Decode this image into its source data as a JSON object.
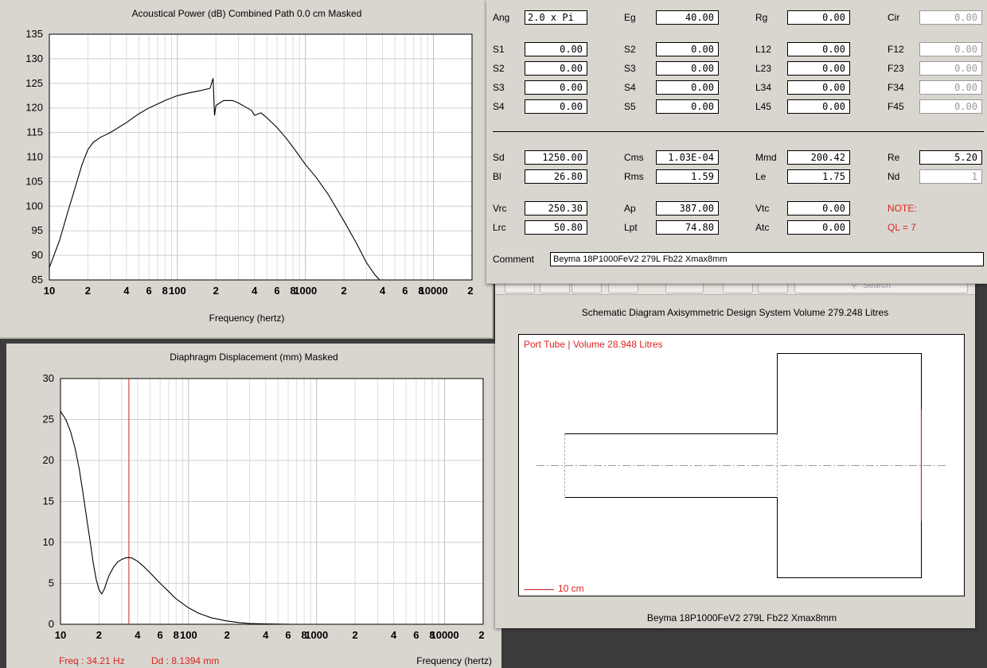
{
  "acoustic_window": {
    "title": "Acoustical Power (dB)   Combined   Path 0.0 cm   Masked",
    "x_caption": "Frequency (hertz)"
  },
  "displacement_window": {
    "title": "Diaphragm Displacement (mm)   Masked",
    "x_caption": "Frequency (hertz)",
    "cursor_freq": "Freq : 34.21 Hz",
    "cursor_dd": "Dd : 8.1394 mm"
  },
  "params_window": {
    "rows": [
      [
        {
          "label": "Ang",
          "value": "2.0 x Pi",
          "align": "left"
        },
        {
          "label": "Eg",
          "value": "40.00"
        },
        {
          "label": "Rg",
          "value": "0.00"
        },
        {
          "label": "Cir",
          "value": "0.00",
          "ro": true
        }
      ],
      [
        {
          "label": "S1",
          "value": "0.00"
        },
        {
          "label": "S2",
          "value": "0.00"
        },
        {
          "label": "L12",
          "value": "0.00"
        },
        {
          "label": "F12",
          "value": "0.00",
          "ro": true
        }
      ],
      [
        {
          "label": "S2",
          "value": "0.00"
        },
        {
          "label": "S3",
          "value": "0.00"
        },
        {
          "label": "L23",
          "value": "0.00"
        },
        {
          "label": "F23",
          "value": "0.00",
          "ro": true
        }
      ],
      [
        {
          "label": "S3",
          "value": "0.00"
        },
        {
          "label": "S4",
          "value": "0.00"
        },
        {
          "label": "L34",
          "value": "0.00"
        },
        {
          "label": "F34",
          "value": "0.00",
          "ro": true
        }
      ],
      [
        {
          "label": "S4",
          "value": "0.00"
        },
        {
          "label": "S5",
          "value": "0.00"
        },
        {
          "label": "L45",
          "value": "0.00"
        },
        {
          "label": "F45",
          "value": "0.00",
          "ro": true
        }
      ],
      [
        {
          "label": "Sd",
          "value": "1250.00"
        },
        {
          "label": "Cms",
          "value": "1.03E-04"
        },
        {
          "label": "Mmd",
          "value": "200.42"
        },
        {
          "label": "Re",
          "value": "5.20"
        }
      ],
      [
        {
          "label": "Bl",
          "value": "26.80"
        },
        {
          "label": "Rms",
          "value": "1.59"
        },
        {
          "label": "Le",
          "value": "1.75"
        },
        {
          "label": "Nd",
          "value": "1",
          "ro": true
        }
      ],
      [
        {
          "label": "Vrc",
          "value": "250.30"
        },
        {
          "label": "Ap",
          "value": "387.00"
        },
        {
          "label": "Vtc",
          "value": "0.00"
        },
        {
          "label": "NOTE:",
          "note": true
        }
      ],
      [
        {
          "label": "Lrc",
          "value": "50.80"
        },
        {
          "label": "Lpt",
          "value": "74.80"
        },
        {
          "label": "Atc",
          "value": "0.00"
        },
        {
          "label": "QL = 7",
          "note": true
        }
      ]
    ],
    "comment_label": "Comment",
    "comment_value": "Beyma 18P1000FeV2 279L Fb22  Xmax8mm"
  },
  "toolbar": {
    "search_placeholder": "Search"
  },
  "schematic_window": {
    "title": "Schematic Diagram   Axisymmetric Design   System Volume 279.248 Litres",
    "port_label": "Port Tube | Volume 28.948 Litres",
    "scale_label": "10 cm",
    "footer": "Beyma 18P1000FeV2 279L Fb22  Xmax8mm"
  },
  "colors": {
    "window_bg": "#d9d6cf",
    "accent_red": "#d22222",
    "desktop": "#3c3c3c"
  },
  "chart_data": [
    {
      "type": "line",
      "title": "Acoustical Power (dB)   Combined   Path 0.0 cm   Masked",
      "xlabel": "Frequency (hertz)",
      "ylabel": "",
      "xscale": "log",
      "xlim": [
        10,
        20000
      ],
      "ylim": [
        85,
        135
      ],
      "x_ticks": [
        "10",
        "2",
        "4",
        "6",
        "8",
        "100",
        "2",
        "4",
        "6",
        "8",
        "1000",
        "2",
        "4",
        "6",
        "8",
        "10000",
        "2"
      ],
      "y_ticks": [
        "135",
        "130",
        "125",
        "120",
        "115",
        "110",
        "105",
        "100",
        "95",
        "90",
        "85"
      ],
      "grid": true,
      "series": [
        {
          "x": [
            10,
            12,
            14,
            16,
            18,
            20,
            22,
            25,
            30,
            40,
            50,
            60,
            80,
            100,
            120,
            150,
            180,
            190,
            195,
            200,
            230,
            270,
            300,
            350,
            380,
            400,
            450,
            500,
            600,
            700,
            800,
            1000,
            1200,
            1500,
            2000,
            2500,
            3000,
            3500,
            3800
          ],
          "y": [
            87.5,
            93,
            99,
            104,
            108.5,
            111.5,
            113,
            114,
            115,
            117,
            118.8,
            120,
            121.5,
            122.5,
            123,
            123.5,
            124,
            126,
            118.5,
            120.5,
            121.5,
            121.5,
            121,
            120,
            119.5,
            118.5,
            119,
            118,
            116,
            114,
            112,
            108.5,
            106,
            102.5,
            97,
            92.5,
            88.5,
            86,
            85
          ]
        }
      ]
    },
    {
      "type": "line",
      "title": "Diaphragm Displacement (mm)   Masked",
      "xlabel": "Frequency (hertz)",
      "ylabel": "",
      "xscale": "log",
      "xlim": [
        10,
        20000
      ],
      "ylim": [
        0,
        30
      ],
      "x_ticks": [
        "10",
        "2",
        "4",
        "6",
        "8",
        "100",
        "2",
        "4",
        "6",
        "8",
        "1000",
        "2",
        "4",
        "6",
        "8",
        "10000",
        "2"
      ],
      "y_ticks": [
        "30",
        "25",
        "20",
        "15",
        "10",
        "5",
        "0"
      ],
      "grid": true,
      "cursor_x": 34.21,
      "series": [
        {
          "x": [
            10,
            11,
            12,
            13,
            14,
            15,
            16,
            17,
            18,
            19,
            20,
            21,
            22,
            23,
            24,
            26,
            28,
            30,
            32,
            34,
            36,
            40,
            45,
            50,
            60,
            70,
            80,
            100,
            120,
            150,
            200,
            250,
            300,
            400,
            500,
            600,
            650
          ],
          "y": [
            26,
            25,
            23.5,
            21.5,
            19,
            16,
            13,
            10.2,
            7.5,
            5.5,
            4.2,
            3.7,
            4.3,
            5.2,
            6,
            7,
            7.6,
            7.9,
            8.1,
            8.15,
            8.1,
            7.7,
            7,
            6.3,
            5,
            4,
            3.1,
            2,
            1.35,
            0.8,
            0.4,
            0.2,
            0.1,
            0.05,
            0.02,
            0.01,
            0
          ]
        }
      ]
    }
  ]
}
